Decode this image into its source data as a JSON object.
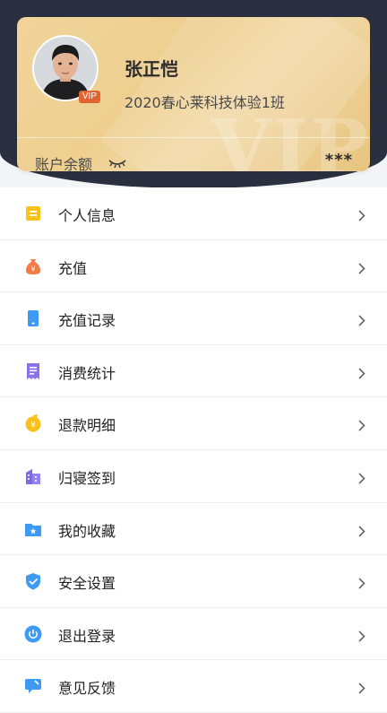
{
  "profile": {
    "name": "张正恺",
    "class": "2020春心莱科技体验1班",
    "vip_badge": "VIP",
    "watermark": "VIP",
    "balance_label": "账户余额",
    "balance_value": "***"
  },
  "menu": {
    "items": [
      {
        "label": "个人信息",
        "icon": "personal-info-icon",
        "color": "#f8c21b"
      },
      {
        "label": "充值",
        "icon": "money-bag-icon",
        "color": "#f47a47"
      },
      {
        "label": "充值记录",
        "icon": "phone-record-icon",
        "color": "#3e9af3"
      },
      {
        "label": "消费统计",
        "icon": "receipt-icon",
        "color": "#8a72e8"
      },
      {
        "label": "退款明细",
        "icon": "refund-coin-icon",
        "color": "#f8c21b"
      },
      {
        "label": "归寝签到",
        "icon": "building-icon",
        "color": "#7b6ae6"
      },
      {
        "label": "我的收藏",
        "icon": "favorite-folder-icon",
        "color": "#3e9af3"
      },
      {
        "label": "安全设置",
        "icon": "shield-icon",
        "color": "#3e9af3"
      },
      {
        "label": "退出登录",
        "icon": "power-icon",
        "color": "#3e9af3"
      },
      {
        "label": "意见反馈",
        "icon": "feedback-icon",
        "color": "#3e9af3"
      }
    ]
  },
  "colors": {
    "header_dark": "#2b3040",
    "card_gold": "#eecf90",
    "vip_badge": "#e06431"
  }
}
